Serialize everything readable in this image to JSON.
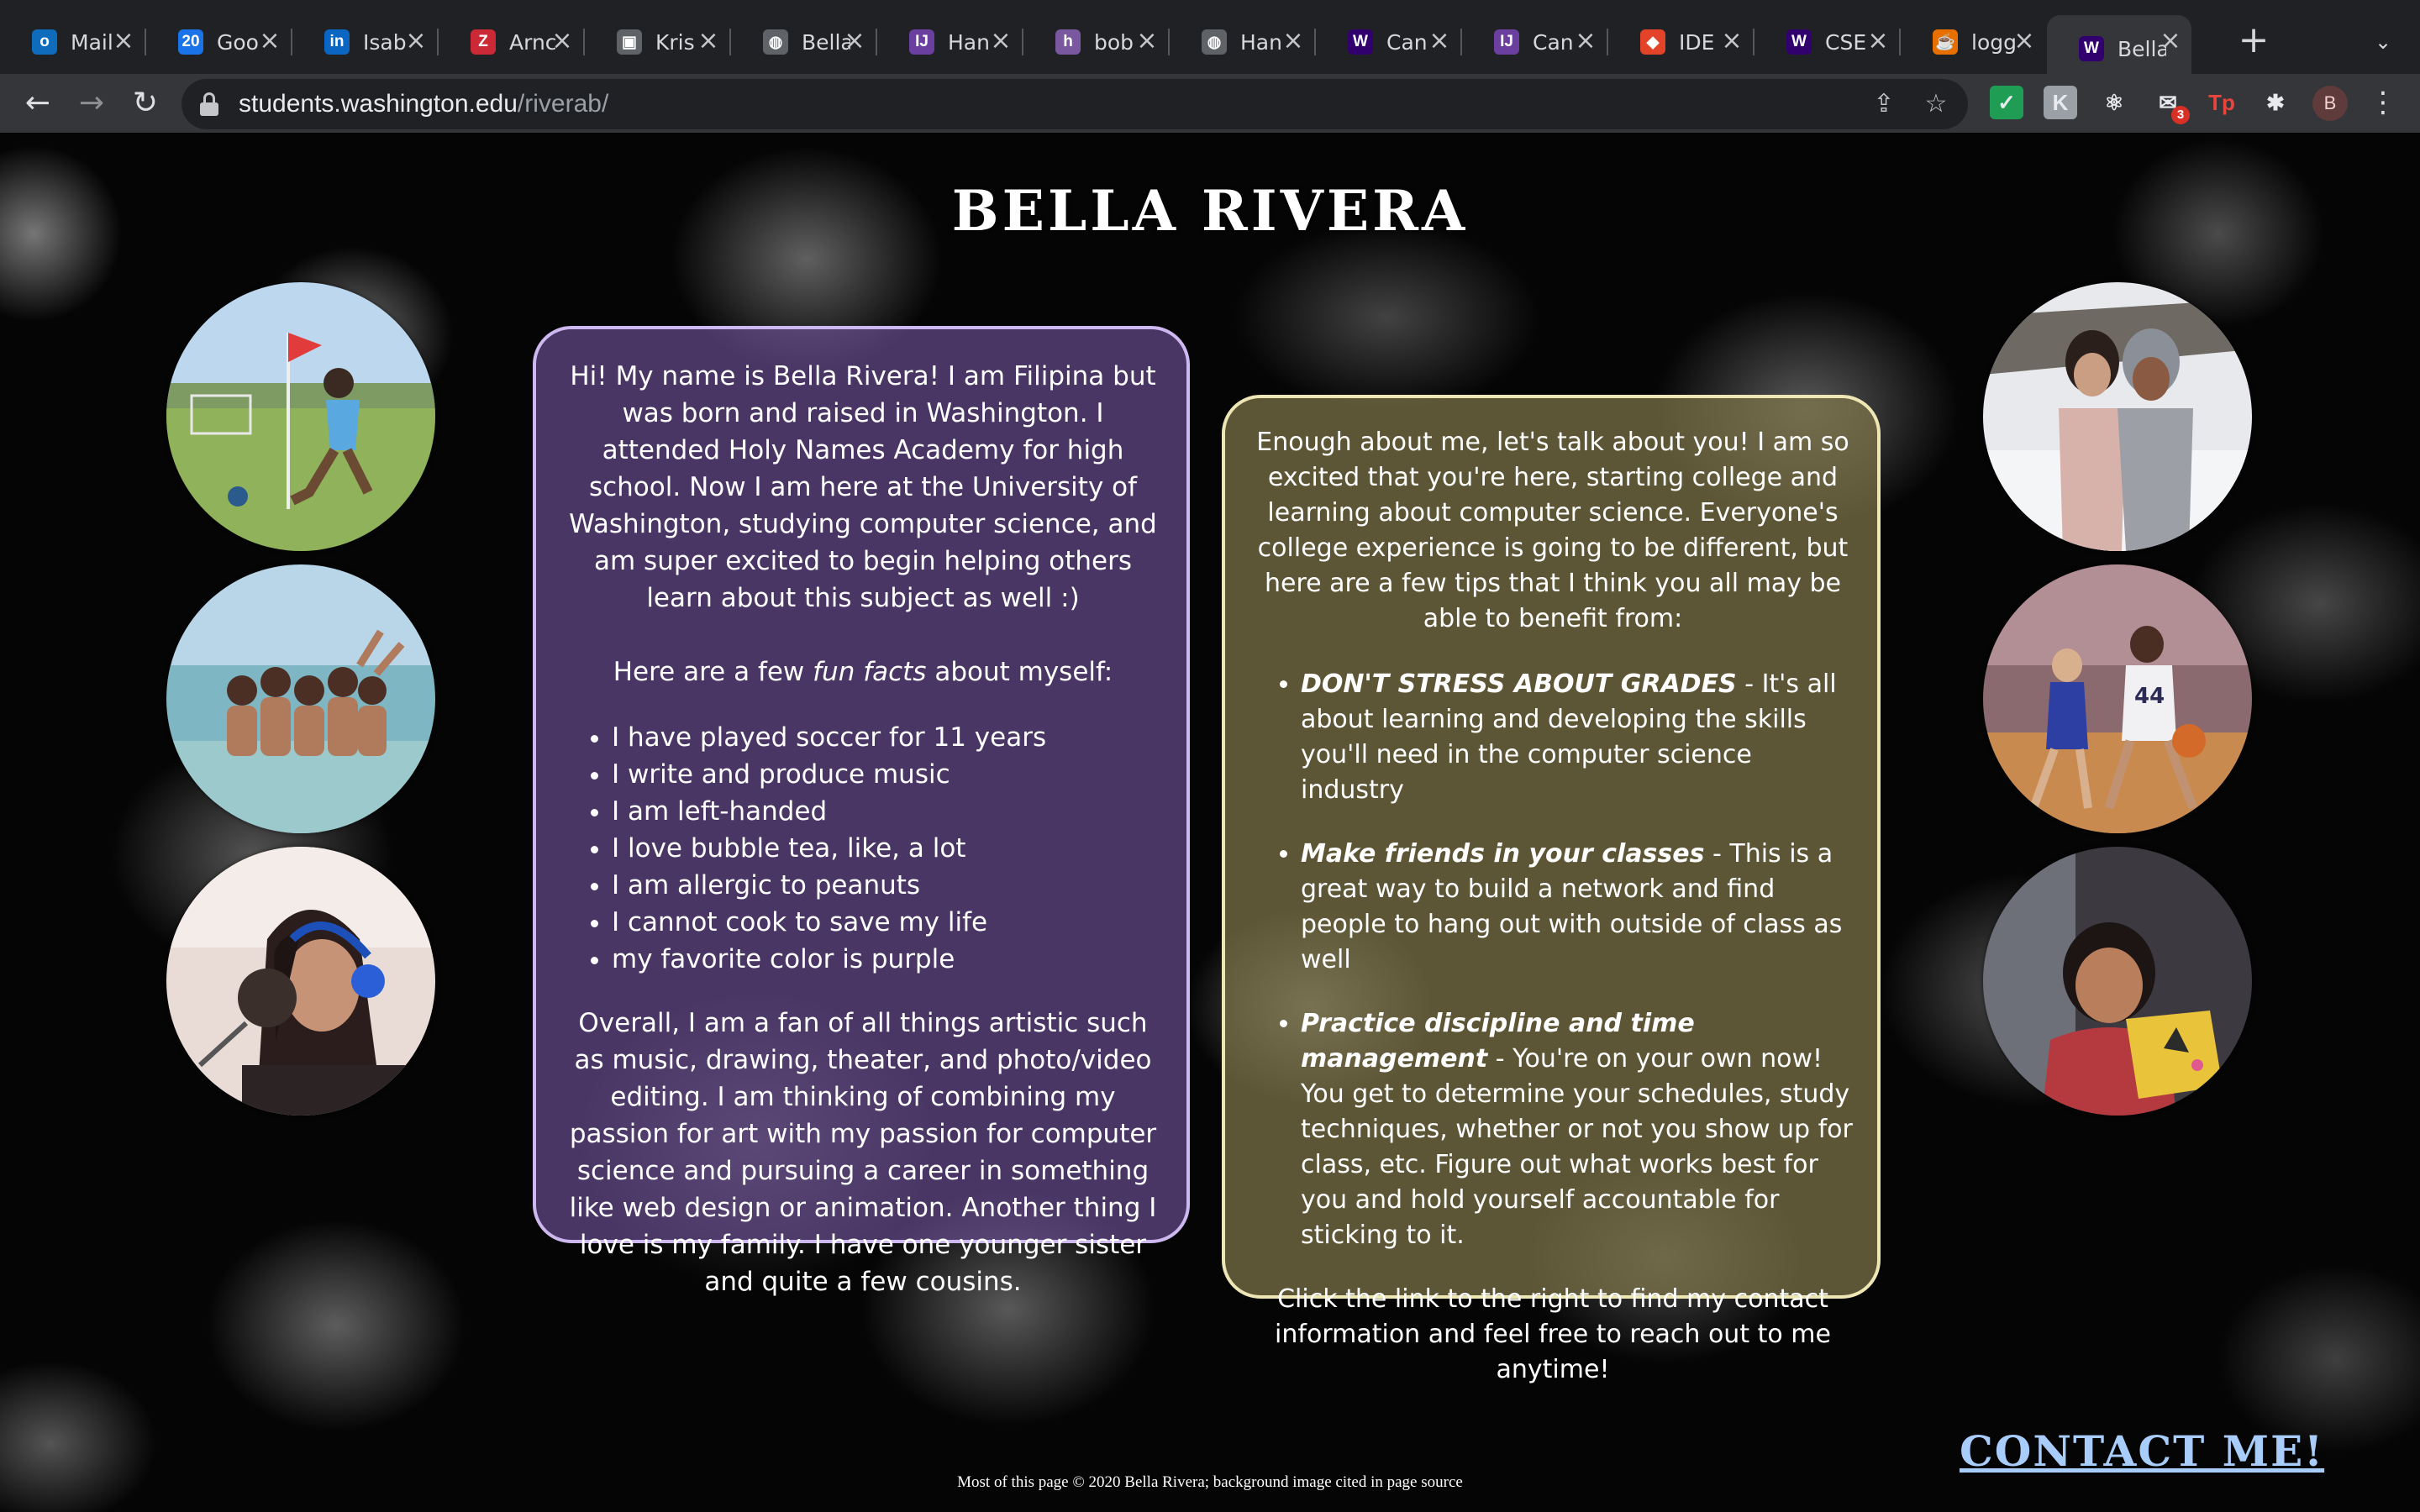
{
  "browser": {
    "tabs": [
      {
        "title": "Mail",
        "icon": "outlook-icon",
        "color": "#0f6cbd",
        "glyph": "o"
      },
      {
        "title": "Goo",
        "icon": "google-calendar-icon",
        "color": "#1a73e8",
        "glyph": "20"
      },
      {
        "title": "Isab",
        "icon": "linkedin-icon",
        "color": "#0a66c2",
        "glyph": "in"
      },
      {
        "title": "Arnc",
        "icon": "zotero-icon",
        "color": "#cc2936",
        "glyph": "Z"
      },
      {
        "title": "Kris",
        "icon": "cube-icon",
        "color": "#5f6368",
        "glyph": "▣"
      },
      {
        "title": "Bella",
        "icon": "globe-icon",
        "color": "#5f6368",
        "glyph": "◍"
      },
      {
        "title": "Han",
        "icon": "intellij-icon",
        "color": "#6b3fa0",
        "glyph": "IJ"
      },
      {
        "title": "bob",
        "icon": "heroku-icon",
        "color": "#79589f",
        "glyph": "h"
      },
      {
        "title": "Han",
        "icon": "globe-icon",
        "color": "#5f6368",
        "glyph": "◍"
      },
      {
        "title": "Can",
        "icon": "uw-icon",
        "color": "#32006e",
        "glyph": "W"
      },
      {
        "title": "Can",
        "icon": "intellij-icon",
        "color": "#6b3fa0",
        "glyph": "IJ"
      },
      {
        "title": "IDE",
        "icon": "gitlab-icon",
        "color": "#e24329",
        "glyph": "◆"
      },
      {
        "title": "CSE",
        "icon": "uw-icon",
        "color": "#32006e",
        "glyph": "W"
      },
      {
        "title": "logg",
        "icon": "java-icon",
        "color": "#e76f00",
        "glyph": "☕"
      },
      {
        "title": "Bella",
        "icon": "uw-icon",
        "color": "#32006e",
        "glyph": "W",
        "active": true
      }
    ],
    "new_tab": "+",
    "url_host": "students.washington.edu",
    "url_path": "/riverab/",
    "extensions": [
      {
        "name": "check-extension-icon",
        "color": "#1f9d55",
        "glyph": "✓"
      },
      {
        "name": "puzzle-k-extension-icon",
        "color": "#9aa0a6",
        "glyph": "K"
      },
      {
        "name": "react-extension-icon",
        "color": "transparent",
        "glyph": "⚛"
      },
      {
        "name": "mail-extension-icon",
        "color": "transparent",
        "glyph": "✉",
        "badge": "3"
      },
      {
        "name": "tp-extension-icon",
        "color": "transparent",
        "glyph": "Tp"
      },
      {
        "name": "extensions-puzzle-icon",
        "color": "transparent",
        "glyph": "✱"
      }
    ],
    "profile_initial": "B"
  },
  "page": {
    "title": "BELLA RIVERA",
    "about": {
      "intro": "Hi! My name is Bella Rivera! I am Filipina but was born and raised in Washington. I attended Holy Names Academy for high school. Now I am here at the University of Washington, studying computer science, and am super excited to begin helping others learn about this subject as well :)",
      "facts_lead_before": "Here are a few ",
      "facts_lead_em": "fun facts",
      "facts_lead_after": " about myself:",
      "facts": [
        "I have played soccer for 11 years",
        "I write and produce music",
        "I am left-handed",
        "I love bubble tea, like, a lot",
        "I am allergic to peanuts",
        "I cannot cook to save my life",
        "my favorite color is purple"
      ],
      "outro": "Overall, I am a fan of all things artistic such as music, drawing, theater, and photo/video editing. I am thinking of combining my passion for art with my passion for computer science and pursuing a career in something like web design or animation. Another thing I love is my family. I have one younger sister and quite a few cousins."
    },
    "tips": {
      "intro": "Enough about me, let's talk about you! I am so excited that you're here, starting college and learning about computer science. Everyone's college experience is going to be different, but here are a few tips that I think you all may be able to benefit from:",
      "items": [
        {
          "title": "DON'T STRESS ABOUT GRADES",
          "text": " - It's all about learning and developing the skills you'll need in the computer science industry"
        },
        {
          "title": "Make friends in your classes",
          "text": " - This is a great way to build a network and find people to hang out with outside of class as well"
        },
        {
          "title": "Practice discipline and time management",
          "text": " - You're on your own now! You get to determine your schedules, study techniques, whether or not you show up for class, etc. Figure out what works best for you and hold yourself accountable for sticking to it."
        }
      ],
      "outro": "Click the link to the right to find my contact information and feel free to reach out to me anytime!"
    },
    "contact_link": "CONTACT ME!",
    "footer": "Most of this page © 2020 Bella Rivera; background image cited in page source"
  }
}
